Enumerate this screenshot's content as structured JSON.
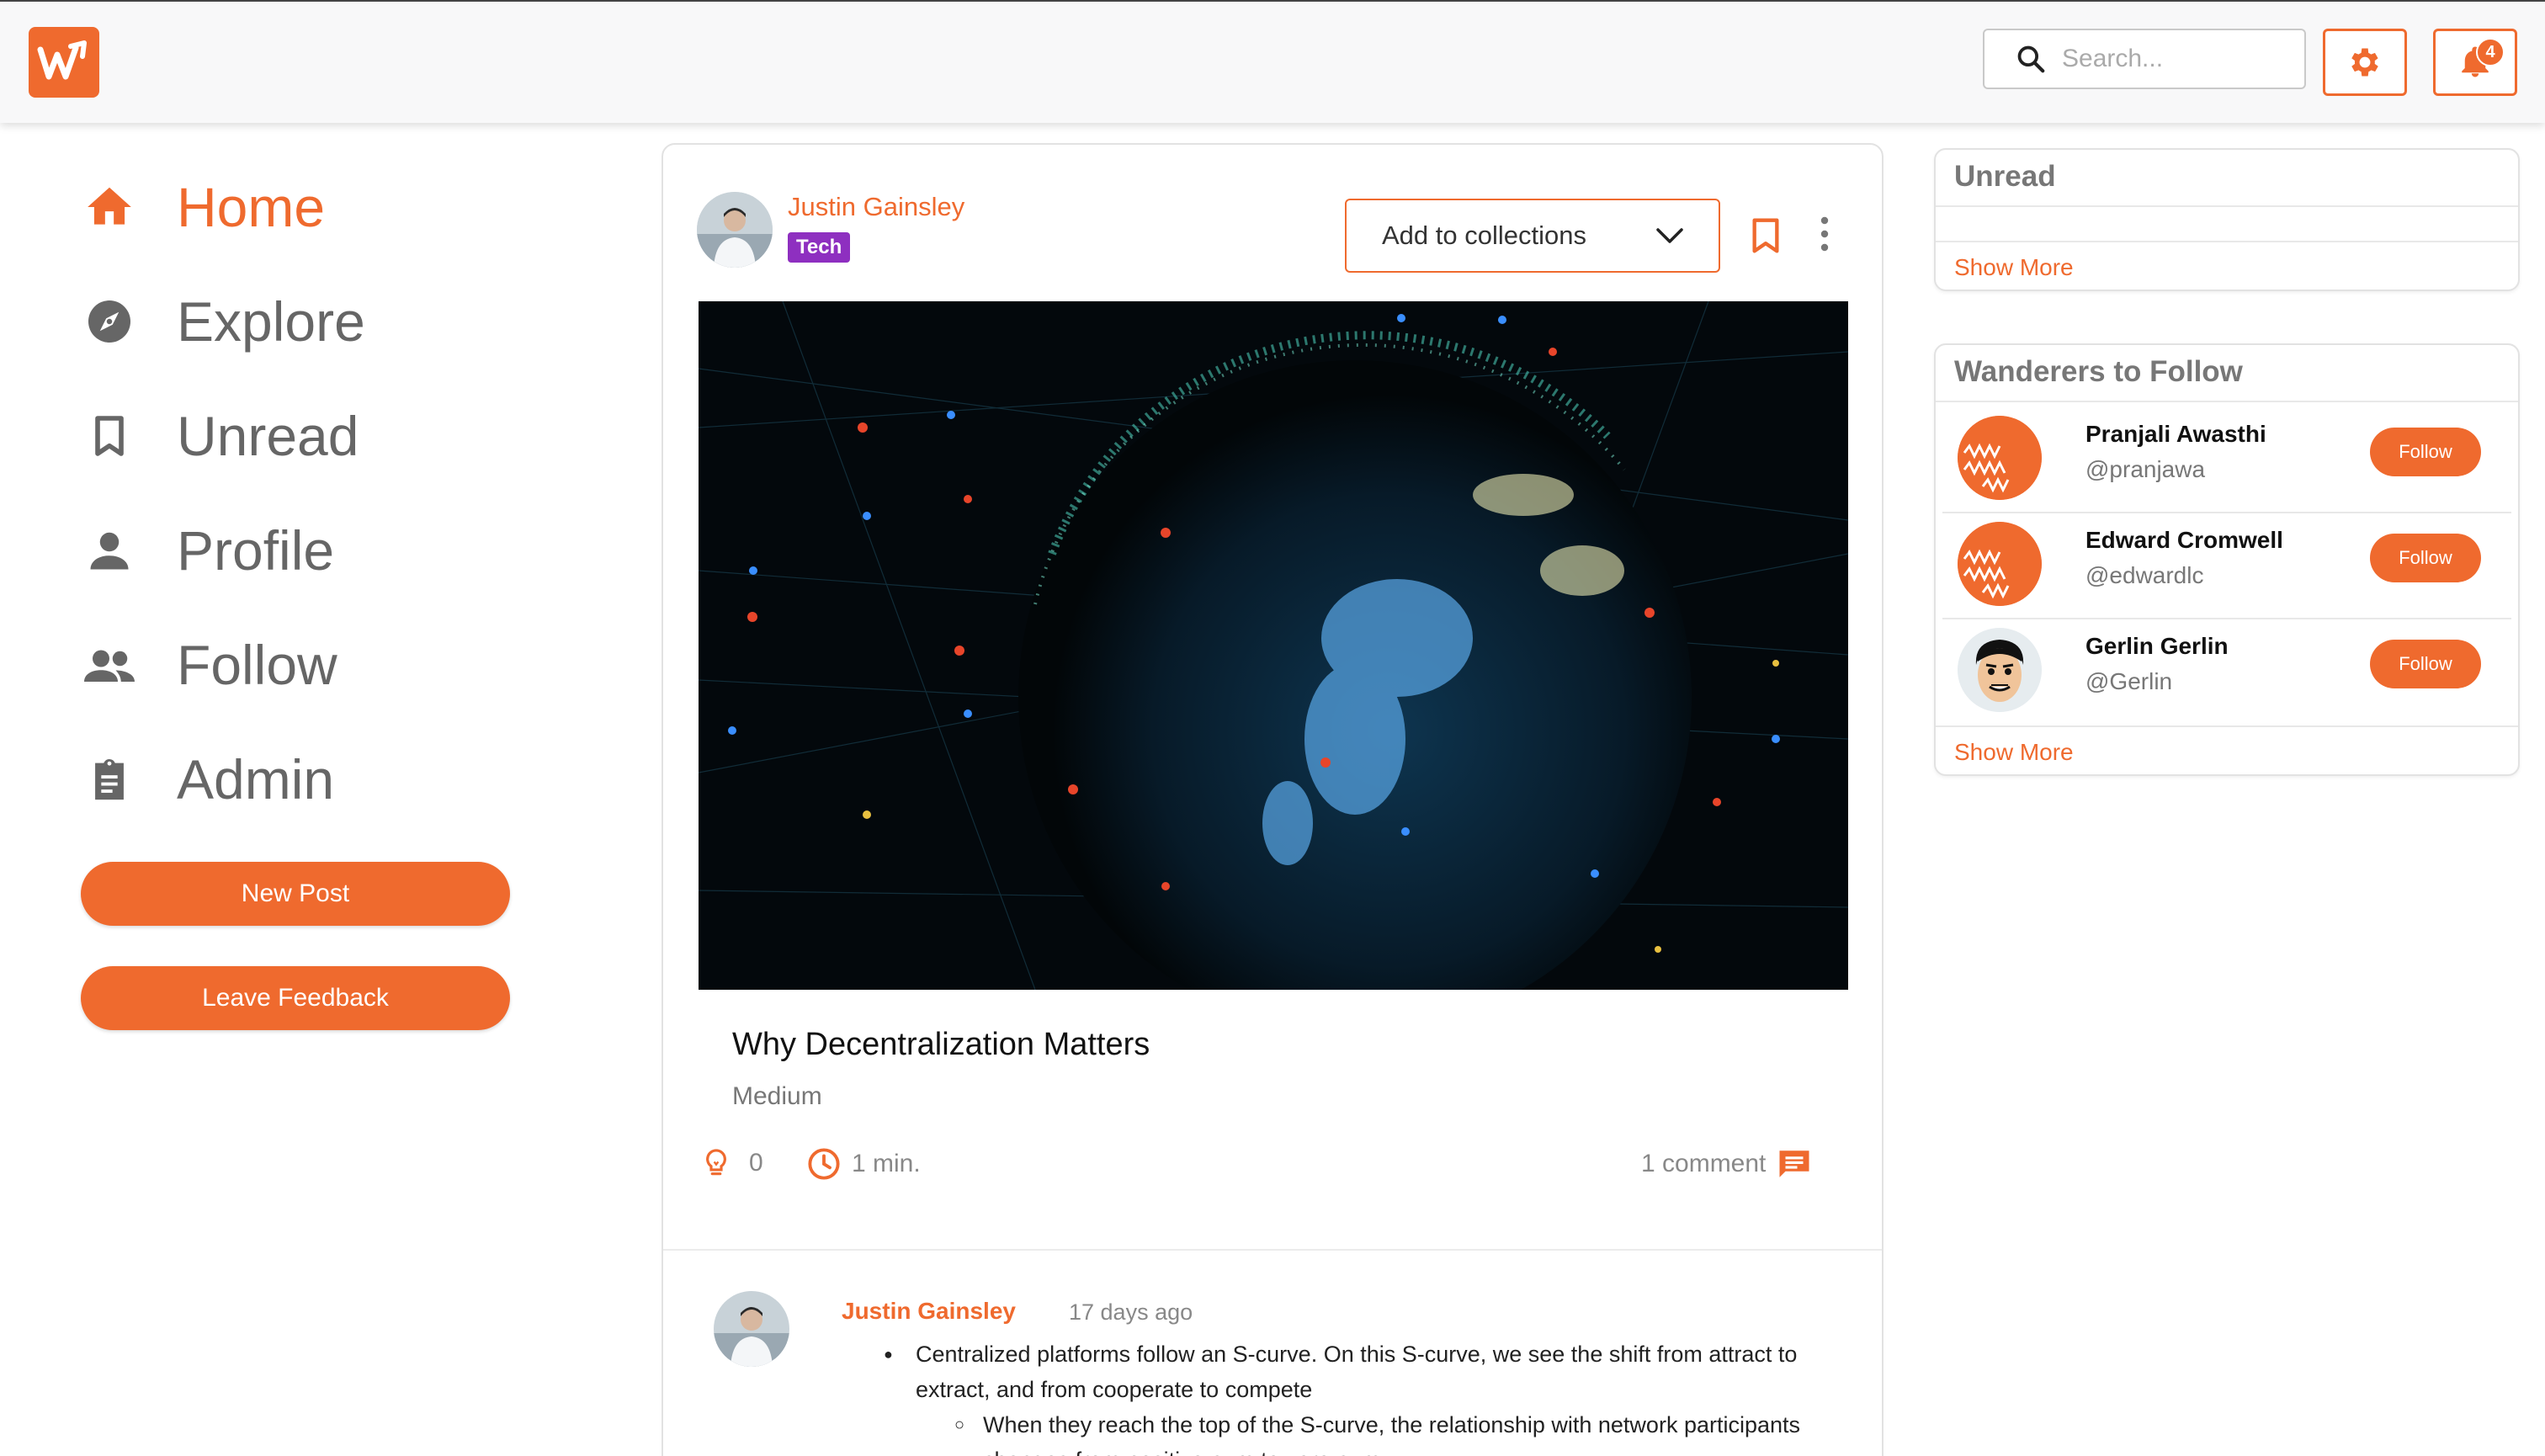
{
  "header": {
    "search_placeholder": "Search...",
    "notification_count": "4"
  },
  "sidebar": {
    "items": [
      {
        "label": "Home",
        "icon": "home-icon",
        "active": true
      },
      {
        "label": "Explore",
        "icon": "compass-icon"
      },
      {
        "label": "Unread",
        "icon": "bookmark-icon"
      },
      {
        "label": "Profile",
        "icon": "person-icon"
      },
      {
        "label": "Follow",
        "icon": "people-icon"
      },
      {
        "label": "Admin",
        "icon": "clipboard-icon"
      }
    ],
    "new_post_label": "New Post",
    "feedback_label": "Leave Feedback"
  },
  "post": {
    "author": "Justin Gainsley",
    "tag": "Tech",
    "collections_label": "Add to collections",
    "title": "Why Decentralization Matters",
    "source": "Medium",
    "likes": "0",
    "read_time": "1 min.",
    "comments": "1 comment"
  },
  "comment": {
    "author": "Justin Gainsley",
    "time": "17 days ago",
    "bullet1": "Centralized platforms follow an S-curve. On this S-curve, we see the shift from attract to extract, and from cooperate to compete",
    "bullet2": "When they reach the top of the S-curve, the relationship with network participants changes from positive-sum to zero-sum"
  },
  "unread_panel": {
    "title": "Unread",
    "show_more": "Show More"
  },
  "wanderers_panel": {
    "title": "Wanderers to Follow",
    "show_more": "Show More",
    "follow_label": "Follow",
    "people": [
      {
        "name": "Pranjali Awasthi",
        "handle": "@pranjawa"
      },
      {
        "name": "Edward Cromwell",
        "handle": "@edwardlc"
      },
      {
        "name": "Gerlin Gerlin",
        "handle": "@Gerlin"
      }
    ]
  },
  "colors": {
    "accent": "#ef6a2e",
    "tag": "#8e2fc0"
  }
}
